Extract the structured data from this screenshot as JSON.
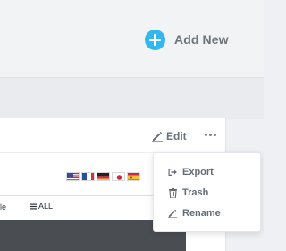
{
  "header": {
    "add_new_label": "Add New",
    "add_new_icon": "plus-circle-icon",
    "accent_color": "#33b8ee"
  },
  "card": {
    "edit_label": "Edit",
    "edit_icon": "pencil-icon",
    "more_icon": "ellipsis-icon",
    "flags": [
      "us-flag-icon",
      "fr-flag-icon",
      "de-flag-icon",
      "jp-flag-icon",
      "es-flag-icon"
    ],
    "filter": {
      "left_text": "le",
      "all_label": "ALL",
      "all_icon": "menu-lines-icon"
    }
  },
  "menu": {
    "items": [
      {
        "label": "Export",
        "icon": "export-icon"
      },
      {
        "label": "Trash",
        "icon": "trash-icon"
      },
      {
        "label": "Rename",
        "icon": "pencil-icon"
      }
    ]
  }
}
